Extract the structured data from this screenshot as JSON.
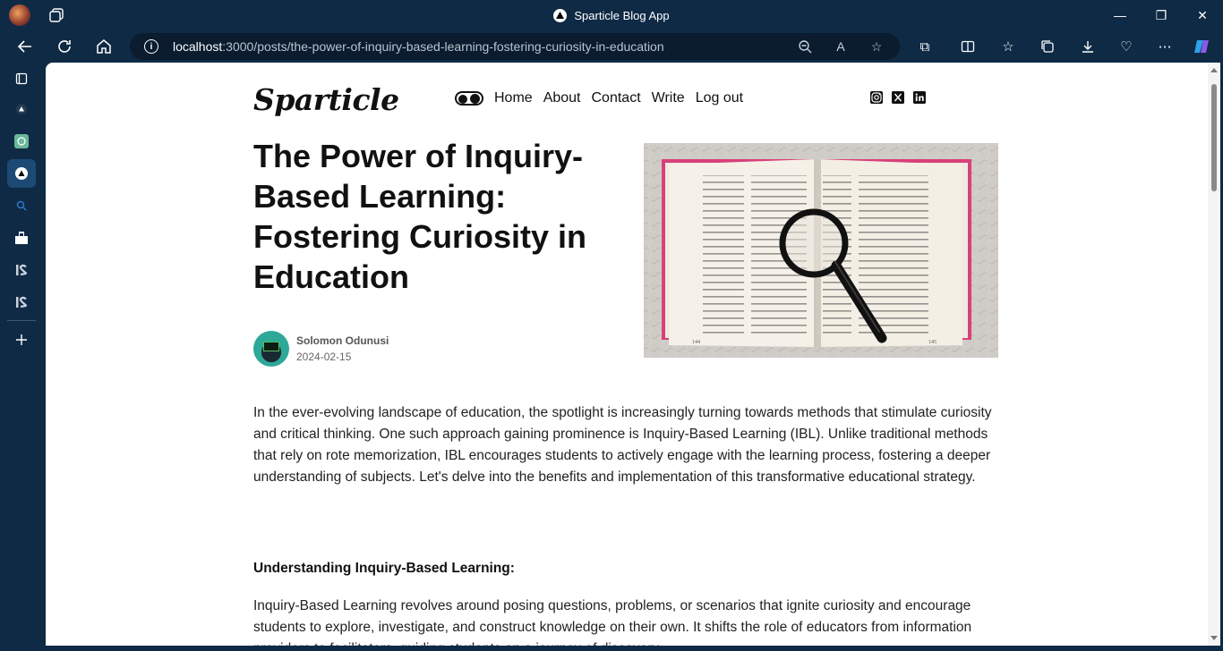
{
  "browser": {
    "window_title": "Sparticle Blog App",
    "url_host": "localhost",
    "url_rest": ":3000/posts/the-power-of-inquiry-based-learning-fostering-curiosity-in-education",
    "minimize_glyph": "—",
    "maximize_glyph": "❐",
    "close_glyph": "✕"
  },
  "site": {
    "logo": "Sparticle",
    "nav": [
      "Home",
      "About",
      "Contact",
      "Write",
      "Log out"
    ],
    "socials": [
      "instagram-icon",
      "x-icon",
      "linkedin-icon"
    ]
  },
  "post": {
    "title": "The Power of Inquiry-Based Learning: Fostering Curiosity in Education",
    "author": "Solomon Odunusi",
    "date": "2024-02-15",
    "intro": "In the ever-evolving landscape of education, the spotlight is increasingly turning towards methods that stimulate curiosity and critical thinking. One such approach gaining prominence is Inquiry-Based Learning (IBL). Unlike traditional methods that rely on rote memorization, IBL encourages students to actively engage with the learning process, fostering a deeper understanding of subjects. Let's delve into the benefits and implementation of this transformative educational strategy.",
    "section_heading": "Understanding Inquiry-Based Learning:",
    "section_body": "Inquiry-Based Learning revolves around posing questions, problems, or scenarios that ignite curiosity and encourage students to explore, investigate, and construct knowledge on their own. It shifts the role of educators from information providers to facilitators, guiding students on a journey of discovery."
  },
  "colors": {
    "chrome": "#0f2a45",
    "page": "#ffffff",
    "text": "#111111"
  }
}
